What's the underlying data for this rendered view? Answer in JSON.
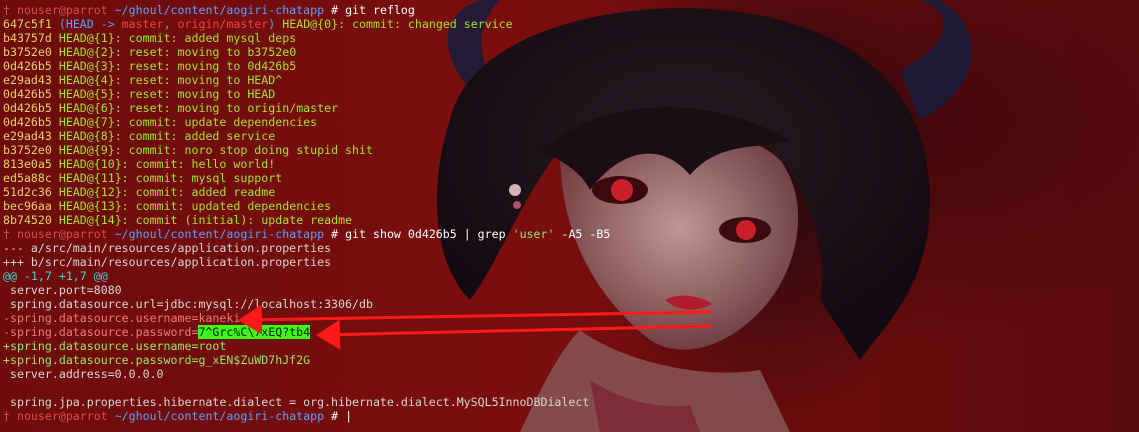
{
  "prompt": {
    "user_host": "nouser@parrot",
    "path": "~/ghoul/content/aogiri-chatapp",
    "symbol": "#"
  },
  "commands": {
    "reflog": "git reflog",
    "show_pre": "git show 0d426b5 | grep ",
    "show_arg": "'user'",
    "show_post": " -A5 -B5"
  },
  "reflog": [
    {
      "hash": "647c5f1",
      "head": "HEAD -> ",
      "branch": "master",
      "sep": ", ",
      "origin": "origin/master",
      "ref": "HEAD@{0}:",
      "msg": " commit: changed service"
    },
    {
      "hash": "b43757d",
      "ref": "HEAD@{1}:",
      "msg": " commit: added mysql deps"
    },
    {
      "hash": "b3752e0",
      "ref": "HEAD@{2}:",
      "msg": " reset: moving to b3752e0"
    },
    {
      "hash": "0d426b5",
      "ref": "HEAD@{3}:",
      "msg": " reset: moving to 0d426b5"
    },
    {
      "hash": "e29ad43",
      "ref": "HEAD@{4}:",
      "msg": " reset: moving to HEAD^"
    },
    {
      "hash": "0d426b5",
      "ref": "HEAD@{5}:",
      "msg": " reset: moving to HEAD"
    },
    {
      "hash": "0d426b5",
      "ref": "HEAD@{6}:",
      "msg": " reset: moving to origin/master"
    },
    {
      "hash": "0d426b5",
      "ref": "HEAD@{7}:",
      "msg": " commit: update dependencies"
    },
    {
      "hash": "e29ad43",
      "ref": "HEAD@{8}:",
      "msg": " commit: added service"
    },
    {
      "hash": "b3752e0",
      "ref": "HEAD@{9}:",
      "msg": " commit: noro stop doing stupid shit"
    },
    {
      "hash": "813e0a5",
      "ref": "HEAD@{10}:",
      "msg": " commit: hello world!"
    },
    {
      "hash": "ed5a88c",
      "ref": "HEAD@{11}:",
      "msg": " commit: mysql support"
    },
    {
      "hash": "51d2c36",
      "ref": "HEAD@{12}:",
      "msg": " commit: added readme"
    },
    {
      "hash": "bec96aa",
      "ref": "HEAD@{13}:",
      "msg": " commit: updated dependencies"
    },
    {
      "hash": "8b74520",
      "ref": "HEAD@{14}:",
      "msg": " commit (initial): update readme"
    }
  ],
  "diff": {
    "old_file": "--- a/src/main/resources/application.properties",
    "new_file": "+++ b/src/main/resources/application.properties",
    "hunk": "@@ -1,7 +1,7 @@",
    "ctx1": " server.port=8080",
    "ctx2": " spring.datasource.url=jdbc:mysql://localhost:3306/db",
    "del_user": "-spring.datasource.username=kaneki",
    "del_pass_key": "-spring.datasource.password=",
    "del_pass_val": "7^Grc%C\\7xEQ?tb4",
    "add_user": "+spring.datasource.username=root",
    "add_pass": "+spring.datasource.password=g_xEN$ZuWD7hJf2G",
    "ctx3": " server.address=0.0.0.0",
    "ctx4": "",
    "ctx5": " spring.jpa.properties.hibernate.dialect = org.hibernate.dialect.MySQL5InnoDBDialect"
  },
  "cursor": "|",
  "colors": {
    "arrow": "#ff1a1a",
    "highlight": "#39ff14"
  }
}
